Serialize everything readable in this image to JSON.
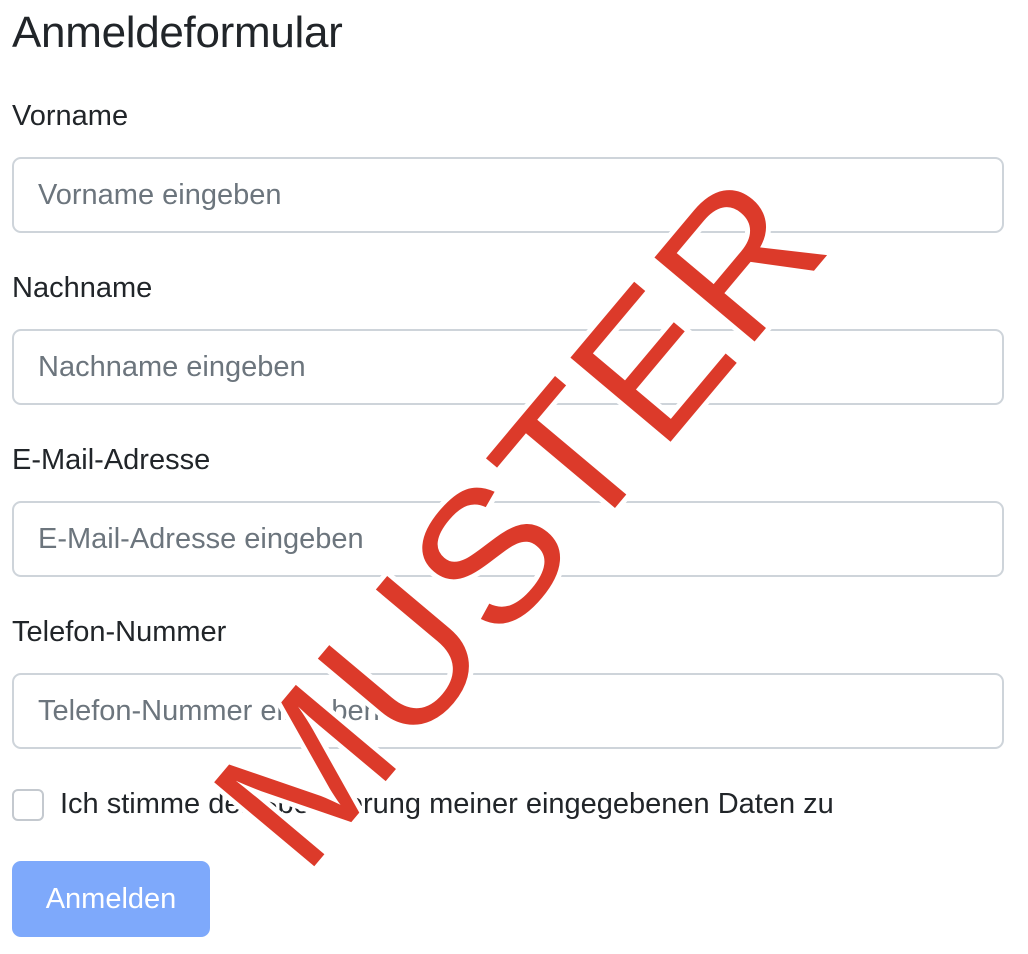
{
  "form": {
    "title": "Anmeldeformular",
    "fields": [
      {
        "label": "Vorname",
        "placeholder": "Vorname eingeben",
        "value": ""
      },
      {
        "label": "Nachname",
        "placeholder": "Nachname eingeben",
        "value": ""
      },
      {
        "label": "E-Mail-Adresse",
        "placeholder": "E-Mail-Adresse eingeben",
        "value": ""
      },
      {
        "label": "Telefon-Nummer",
        "placeholder": "Telefon-Nummer eingeben",
        "value": ""
      }
    ],
    "consent": {
      "label": "Ich stimme der Speicherung meiner eingegebenen Daten zu",
      "checked": false
    },
    "submit_label": "Anmelden"
  },
  "watermark": {
    "text": "MUSTER",
    "color": "#dc3a2a"
  },
  "colors": {
    "button": "#7ea9fb",
    "border": "#ced4da",
    "placeholder": "#6c757d",
    "text": "#212529"
  }
}
